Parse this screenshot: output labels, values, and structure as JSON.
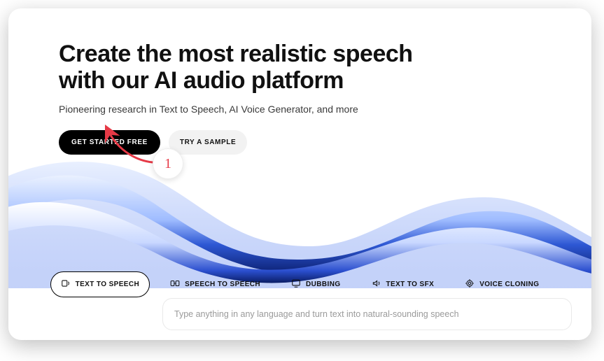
{
  "hero": {
    "headline_line1": "Create the most realistic speech",
    "headline_line2": "with our AI audio platform",
    "subhead": "Pioneering research in Text to Speech, AI Voice Generator, and more"
  },
  "cta": {
    "primary": "GET STARTED FREE",
    "secondary": "TRY A SAMPLE"
  },
  "annotation": {
    "step": "1"
  },
  "tabs": {
    "0": {
      "label": "TEXT TO SPEECH"
    },
    "1": {
      "label": "SPEECH TO SPEECH"
    },
    "2": {
      "label": "DUBBING"
    },
    "3": {
      "label": "TEXT TO SFX"
    },
    "4": {
      "label": "VOICE CLONING"
    }
  },
  "prompt": {
    "placeholder": "Type anything in any language and turn text into natural-sounding speech"
  }
}
